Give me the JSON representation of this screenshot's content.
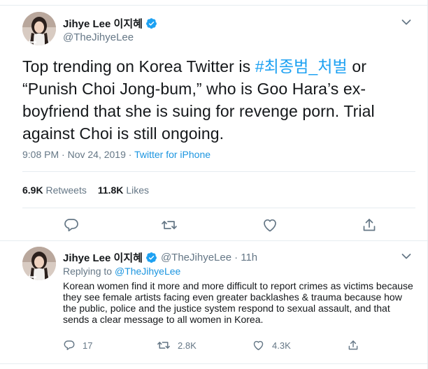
{
  "main_tweet": {
    "author": {
      "name": "Jihye Lee 이지혜",
      "handle": "@TheJihyeLee"
    },
    "text_before": "Top trending on Korea Twitter is ",
    "hashtag": "#최종범_처벌",
    "text_after": " or “Punish Choi Jong-bum,” who is Goo Hara’s ex-boyfriend that she is suing for revenge porn. Trial against Choi is still ongoing.",
    "timestamp": "9:08 PM · Nov 24, 2019",
    "separator": " · ",
    "source": "Twitter for iPhone",
    "stats": {
      "retweets_count": "6.9K",
      "retweets_label": "Retweets",
      "likes_count": "11.8K",
      "likes_label": "Likes"
    }
  },
  "reply_tweet": {
    "author": {
      "name": "Jihye Lee 이지혜",
      "handle": "@TheJihyeLee",
      "time": "· 11h"
    },
    "replying_label": "Replying to ",
    "replying_to": "@TheJihyeLee",
    "text": "Korean women find it more and more difficult to report crimes as victims because they see female artists facing even greater backlashes & trauma because how the public, police and the justice system respond to sexual assault, and that sends a clear message to all women in Korea.",
    "replies_count": "17",
    "retweets_count": "2.8K",
    "likes_count": "4.3K"
  },
  "colors": {
    "accent": "#1da1f2",
    "link": "#1b95e0",
    "secondary_text": "#657786",
    "border": "#e6ecf0",
    "verified": "#1da1f2"
  },
  "icons": {
    "reply": "reply-icon",
    "retweet": "retweet-icon",
    "like": "heart-icon",
    "share": "share-icon",
    "verified": "verified-badge-icon",
    "more": "chevron-down-icon"
  }
}
